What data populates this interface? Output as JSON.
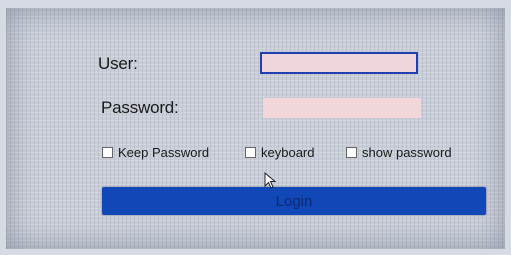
{
  "form": {
    "user_label": "User:",
    "user_value": "",
    "password_label": "Password:",
    "password_value": "",
    "options": [
      {
        "label": "Keep Password",
        "checked": false
      },
      {
        "label": "keyboard",
        "checked": false
      },
      {
        "label": "show password",
        "checked": false
      }
    ],
    "login_label": "Login"
  },
  "colors": {
    "accent": "#1247b8",
    "field_bg": "#f2d7da",
    "focus_border": "#1f3fae"
  },
  "icons": {
    "cursor": "mouse-pointer-icon"
  }
}
